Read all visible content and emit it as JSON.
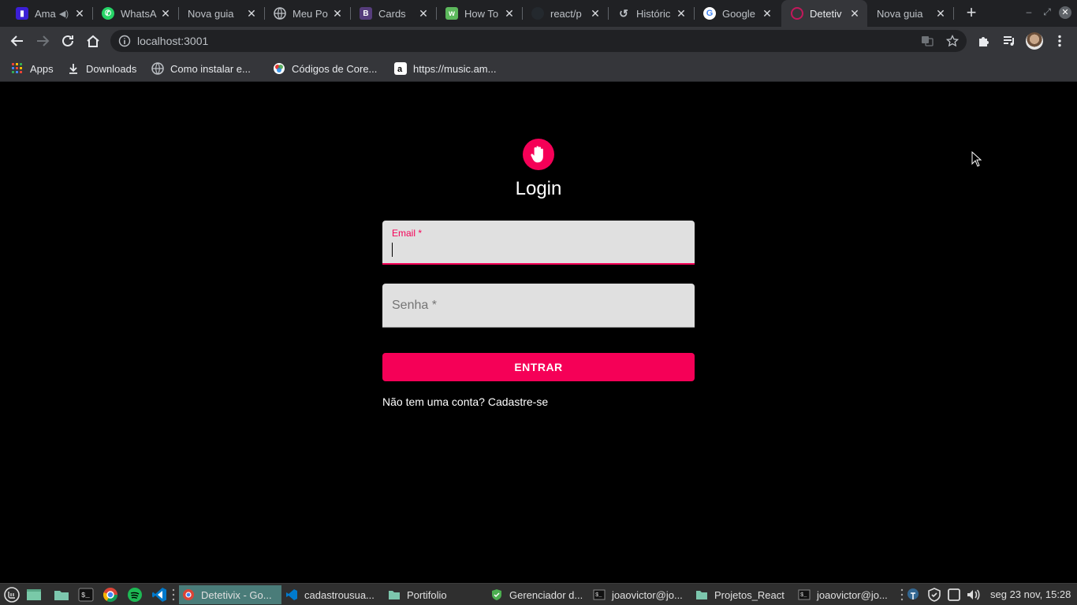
{
  "browser": {
    "tabs": [
      {
        "title": "Ama",
        "icon": "amazon-music-icon",
        "audio": true
      },
      {
        "title": "WhatsA",
        "icon": "whatsapp-icon"
      },
      {
        "title": "Nova guia",
        "icon": ""
      },
      {
        "title": "Meu Po",
        "icon": "globe-icon"
      },
      {
        "title": "Cards",
        "icon": "bootstrap-icon"
      },
      {
        "title": "How To",
        "icon": "howto-icon"
      },
      {
        "title": "react/p",
        "icon": "github-icon"
      },
      {
        "title": "Históric",
        "icon": "history-icon"
      },
      {
        "title": "Google",
        "icon": "google-icon"
      },
      {
        "title": "Detetiv",
        "icon": "detetivix-icon",
        "active": true
      },
      {
        "title": "Nova guia",
        "icon": ""
      }
    ],
    "address": "localhost:3001",
    "bookmarks": [
      {
        "label": "Apps",
        "icon": "apps-grid-icon"
      },
      {
        "label": "Downloads",
        "icon": "download-icon"
      },
      {
        "label": "Como instalar e...",
        "icon": "globe-icon"
      },
      {
        "label": "Códigos de Core...",
        "icon": "color-wheel-icon"
      },
      {
        "label": "https://music.am...",
        "icon": "amazon-icon"
      }
    ]
  },
  "login": {
    "title": "Login",
    "email_label": "Email *",
    "email_value": "",
    "senha_label": "Senha *",
    "button": "ENTRAR",
    "signup_text": "Não tem uma conta? Cadastre-se",
    "accent": "#f50057"
  },
  "taskbar": {
    "windows": [
      {
        "label": "Detetivix - Go...",
        "active": true
      },
      {
        "label": "cadastrousua..."
      },
      {
        "label": "Portifolio"
      },
      {
        "label": "Gerenciador d..."
      },
      {
        "label": "joaovictor@jo..."
      },
      {
        "label": "Projetos_React"
      },
      {
        "label": "joaovictor@jo..."
      }
    ],
    "clock": "seg 23 nov, 15:28"
  }
}
